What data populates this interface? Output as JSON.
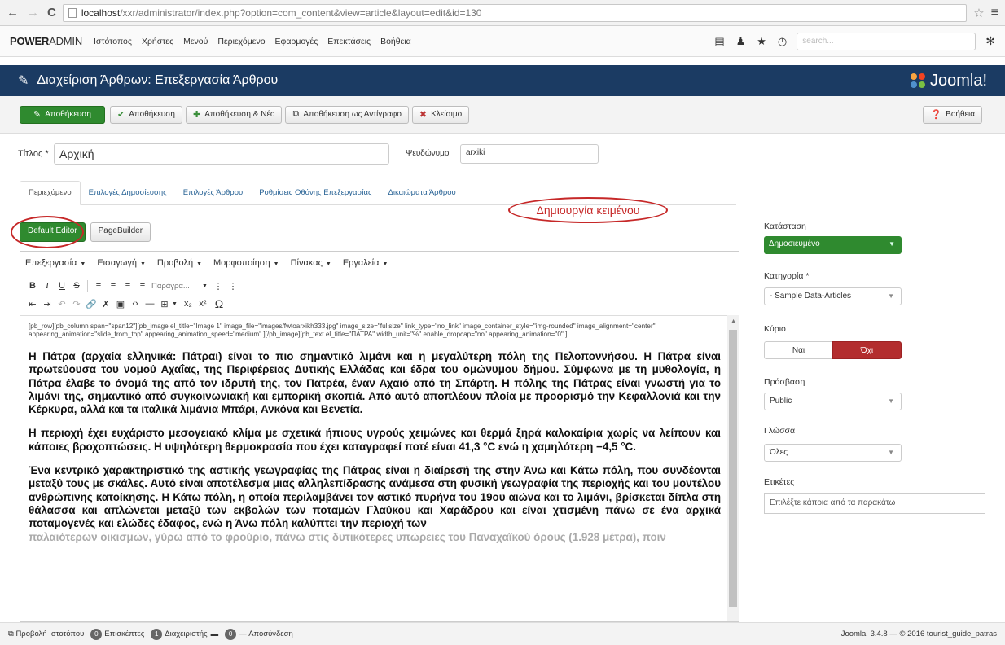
{
  "browser": {
    "url_host": "localhost",
    "url_path": "/xxr/administrator/index.php?option=com_content&view=article&layout=edit&id=130"
  },
  "topnav": {
    "brand_bold": "POWER",
    "brand_rest": "ADMIN",
    "items": [
      "Ιστότοπος",
      "Χρήστες",
      "Μενού",
      "Περιεχόμενο",
      "Εφαρμογές",
      "Επεκτάσεις",
      "Βοήθεια"
    ],
    "search_placeholder": "search..."
  },
  "titlebar": {
    "title": "Διαχείριση Άρθρων: Επεξεργασία Άρθρου",
    "logo_text": "Joomla!"
  },
  "toolbar": {
    "save": "Αποθήκευση",
    "save_close": "Αποθήκευση",
    "save_new": "Αποθήκευση & Νέο",
    "save_copy": "Αποθήκευση ως Αντίγραφο",
    "close": "Κλείσιμο",
    "help": "Βοήθεια"
  },
  "form": {
    "title_label": "Τίτλος *",
    "title_value": "Αρχική",
    "alias_label": "Ψευδώνυμο",
    "alias_value": "arxiki"
  },
  "tabs": [
    "Περιεχόμενο",
    "Επιλογές Δημοσίευσης",
    "Επιλογές Άρθρου",
    "Ρυθμίσεις Οθόνης Επεξεργασίας",
    "Δικαιώματα Άρθρου"
  ],
  "annotation": "Δημιουργία κειμένου",
  "editor_buttons": {
    "default": "Default Editor",
    "pagebuilder": "PageBuilder"
  },
  "editor_menu": [
    "Επεξεργασία",
    "Εισαγωγή",
    "Προβολή",
    "Μορφοποίηση",
    "Πίνακας",
    "Εργαλεία"
  ],
  "editor_format_placeholder": "Παράγρα...",
  "editor_content": {
    "shortcode": "[pb_row][pb_column span=\"span12\"][pb_image el_title=\"Image 1\" image_file=\"images/fwtoarxikh333.jpg\" image_size=\"fullsize\" link_type=\"no_link\" image_container_style=\"img-rounded\" image_alignment=\"center\" appearing_animation=\"slide_from_top\" appearing_animation_speed=\"medium\" ][/pb_image][pb_text el_title=\"ΠΑΤΡΑ\" width_unit=\"%\" enable_dropcap=\"no\" appearing_animation=\"0\" ]",
    "p1": " Η Πάτρα (αρχαία ελληνικά: Πάτραι) είναι το πιο σημαντικό λιμάνι και η μεγαλύτερη πόλη της Πελοποννήσου. Η Πάτρα είναι πρωτεύουσα του νομού Αχαΐας, της Περιφέρειας Δυτικής Ελλάδας και έδρα του ομώνυμου δήμου. Σύμφωνα με τη μυθολογία, η Πάτρα έλαβε το όνομά της από τον ιδρυτή της, τον Πατρέα, έναν Αχαιό από τη Σπάρτη. Η πόλης της Πάτρας είναι γνωστή για το λιμάνι της, σημαντικό από συγκοινωνιακή και εμπορική σκοπιά. Από αυτό αποπλέουν πλοία με προορισμό την Κεφαλλονιά και την Κέρκυρα, αλλά και τα ιταλικά λιμάνια Μπάρι, Ανκόνα και Βενετία.",
    "p2": "Η περιοχή έχει ευχάριστο μεσογειακό κλίμα με σχετικά ήπιους υγρούς χειμώνες και θερμά ξηρά καλοκαίρια χωρίς να λείπουν και κάποιες βροχοπτώσεις. Η υψηλότερη θερμοκρασία που έχει καταγραφεί ποτέ είναι 41,3 °C ενώ η χαμηλότερη −4,5 °C.",
    "p3": "Ένα κεντρικό χαρακτηριστικό της αστικής γεωγραφίας της Πάτρας είναι η διαίρεσή της στην Άνω και Κάτω πόλη, που συνδέονται μεταξύ τους με σκάλες. Αυτό είναι αποτέλεσμα μιας αλληλεπίδρασης ανάμεσα στη φυσική γεωγραφία της περιοχής και του μοντέλου ανθρώπινης κατοίκησης. Η Κάτω πόλη, η οποία περιλαμβάνει τον αστικό πυρήνα του 19ου αιώνα και το λιμάνι, βρίσκεται δίπλα στη θάλασσα και απλώνεται μεταξύ των εκβολών των ποταμών Γλαύκου και Χαράδρου και είναι χτισμένη πάνω σε ένα αρχικά ποταμογενές και ελώδες έδαφος, ενώ η Άνω πόλη καλύπτει την περιοχή των",
    "p3_fade": "παλαιότερων οικισμών, γύρω από το φρούριο, πάνω στις δυτικότερες υπώρειες του Παναχαϊκού όρους (1.928 μέτρα), ποιν"
  },
  "sidebar": {
    "status_label": "Κατάσταση",
    "status_value": "Δημοσιευμένο",
    "category_label": "Κατηγορία *",
    "category_value": "- Sample Data-Articles",
    "featured_label": "Κύριο",
    "featured_yes": "Ναι",
    "featured_no": "Όχι",
    "access_label": "Πρόσβαση",
    "access_value": "Public",
    "language_label": "Γλώσσα",
    "language_value": "Όλες",
    "tags_label": "Ετικέτες",
    "tags_placeholder": "Επιλέξτε κάποια από τα παρακάτω"
  },
  "statusbar": {
    "view_site": "Προβολή Ιστοτόπου",
    "visitors_count": "0",
    "visitors_label": "Επισκέπτες",
    "admins_count": "1",
    "admins_label": "Διαχειριστής",
    "messages_count": "0",
    "logout": "Αποσύνδεση",
    "footer": "Joomla! 3.4.8 — © 2016 tourist_guide_patras"
  },
  "colors": {
    "title_bar": "#1b3b63",
    "success_green": "#2f8a2f",
    "danger_red": "#b32d2e",
    "annotation_red": "#c62828"
  }
}
